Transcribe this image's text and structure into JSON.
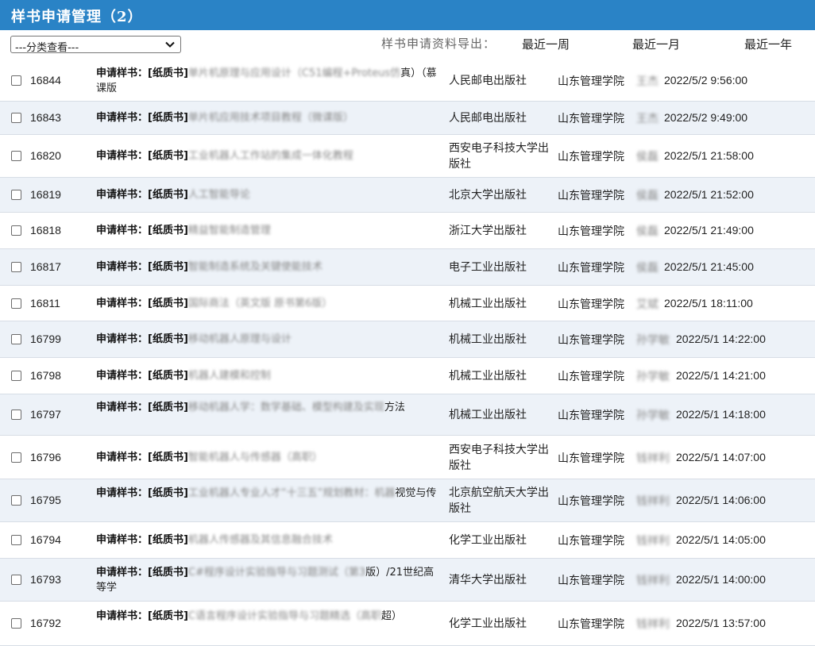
{
  "header": {
    "title": "样书申请管理（2）"
  },
  "toolbar": {
    "filter_value": "---分类查看---",
    "export_label": "样书申请资料导出：",
    "export_links": [
      "最近一周",
      "最近一月",
      "最近一年"
    ]
  },
  "labels": {
    "apply": "申请样书：",
    "paper": "[纸质书]"
  },
  "rows": [
    {
      "id": "16844",
      "book": "单片机原理与应用设计（C51编程+Proteus仿",
      "book_rest": "真）（慕课版",
      "publisher": "人民邮电出版社",
      "school": "山东管理学院",
      "person": "王杰",
      "time": "2022/5/2 9:56:00"
    },
    {
      "id": "16843",
      "book": "单片机应用技术项目教程（微课版）",
      "book_rest": "",
      "publisher": "人民邮电出版社",
      "school": "山东管理学院",
      "person": "王杰",
      "time": "2022/5/2 9:49:00"
    },
    {
      "id": "16820",
      "book": "工业机器人工作站的集成一体化教程",
      "book_rest": "",
      "publisher": "西安电子科技大学出版社",
      "school": "山东管理学院",
      "person": "侯磊",
      "time": "2022/5/1 21:58:00"
    },
    {
      "id": "16819",
      "book": "人工智能导论",
      "book_rest": "",
      "publisher": "北京大学出版社",
      "school": "山东管理学院",
      "person": "侯磊",
      "time": "2022/5/1 21:52:00"
    },
    {
      "id": "16818",
      "book": "精益智能制造管理",
      "book_rest": "",
      "publisher": "浙江大学出版社",
      "school": "山东管理学院",
      "person": "侯磊",
      "time": "2022/5/1 21:49:00"
    },
    {
      "id": "16817",
      "book": "智能制造系统及关键使能技术",
      "book_rest": "",
      "publisher": "电子工业出版社",
      "school": "山东管理学院",
      "person": "侯磊",
      "time": "2022/5/1 21:45:00"
    },
    {
      "id": "16811",
      "book": "国际商法（英文版 原书第6版）",
      "book_rest": "",
      "publisher": "机械工业出版社",
      "school": "山东管理学院",
      "person": "艾斌",
      "time": "2022/5/1 18:11:00"
    },
    {
      "id": "16799",
      "book": "移动机器人原理与设计",
      "book_rest": "",
      "publisher": "机械工业出版社",
      "school": "山东管理学院",
      "person": "孙学敏",
      "time": "2022/5/1 14:22:00"
    },
    {
      "id": "16798",
      "book": "机器人建模和控制",
      "book_rest": "",
      "publisher": "机械工业出版社",
      "school": "山东管理学院",
      "person": "孙学敏",
      "time": "2022/5/1 14:21:00"
    },
    {
      "id": "16797",
      "book": "移动机器人学：数学基础、模型构建及实现",
      "book_rest": "方法",
      "publisher": "机械工业出版社",
      "school": "山东管理学院",
      "person": "孙学敏",
      "time": "2022/5/1 14:18:00"
    },
    {
      "id": "16796",
      "book": "智能机器人与传感器（高职）",
      "book_rest": "",
      "publisher": "西安电子科技大学出版社",
      "school": "山东管理学院",
      "person": "钱祥利",
      "time": "2022/5/1 14:07:00"
    },
    {
      "id": "16795",
      "book": "工业机器人专业人才“十三五”规划教材：机器",
      "book_rest": "视觉与传",
      "publisher": "北京航空航天大学出版社",
      "school": "山东管理学院",
      "person": "钱祥利",
      "time": "2022/5/1 14:06:00"
    },
    {
      "id": "16794",
      "book": "机器人传感器及其信息融合技术",
      "book_rest": "",
      "publisher": "化学工业出版社",
      "school": "山东管理学院",
      "person": "钱祥利",
      "time": "2022/5/1 14:05:00"
    },
    {
      "id": "16793",
      "book": "C#程序设计实验指导与习题测试（第3",
      "book_rest": "版）/21世纪高等学",
      "publisher": "清华大学出版社",
      "school": "山东管理学院",
      "person": "钱祥利",
      "time": "2022/5/1 14:00:00"
    },
    {
      "id": "16792",
      "book": "C语言程序设计实验指导与习题精选（高职",
      "book_rest": "超）",
      "publisher": "化学工业出版社",
      "school": "山东管理学院",
      "person": "钱祥利",
      "time": "2022/5/1 13:57:00"
    }
  ]
}
